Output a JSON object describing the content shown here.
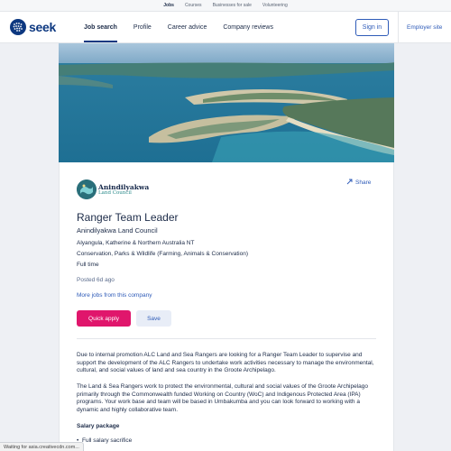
{
  "top_links": [
    "Jobs",
    "Courses",
    "Businesses for sale",
    "Volunteering"
  ],
  "header": {
    "logo_text": "seek",
    "nav": [
      "Job search",
      "Profile",
      "Career advice",
      "Company reviews"
    ],
    "signin_label": "Sign in",
    "employer_label": "Employer site"
  },
  "colors": {
    "brand": "#0d3880",
    "accent": "#e0166c",
    "link": "#2e5bb8"
  },
  "job": {
    "brand_name": "Anindilyakwa",
    "brand_sub": "Land Council",
    "share_label": "Share",
    "title": "Ranger Team Leader",
    "company": "Anindilyakwa Land Council",
    "location": "Alyangula, Katherine & Northern Australia NT",
    "classification": "Conservation, Parks & Wildlife (Farming, Animals & Conservation)",
    "work_type": "Full time",
    "posted": "Posted 6d ago",
    "more_jobs_label": "More jobs from this company",
    "quick_apply_label": "Quick apply",
    "save_label": "Save"
  },
  "description": {
    "para1": "Due to internal promotion ALC Land and Sea Rangers are looking for a Ranger Team Leader to supervise and support the development of the ALC Rangers to undertake work activities necessary to manage the environmental, cultural, and social values of land and sea country in the Groote Archipelago.",
    "para2": "The Land & Sea Rangers work to protect the environmental, cultural and social values of the Groote Archipelago primarily through the Commonwealth funded Working on Country (WoC) and Indigenous Protected Area (IPA) programs. Your work base and team will be based in Umbakumba and you can look forward to working with a dynamic and highly collaborative team.",
    "salary_heading": "Salary package",
    "bullet1": "Full salary sacrifice"
  },
  "status_text": "Waiting for asia.creativecdn.com..."
}
